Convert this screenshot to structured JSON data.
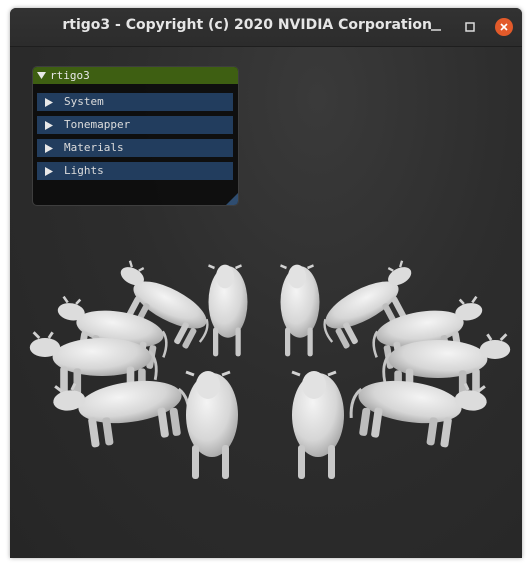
{
  "window": {
    "title": "rtigo3 - Copyright (c) 2020 NVIDIA Corporation",
    "minimize_glyph": "–",
    "maximize_glyph": "□",
    "close_glyph": "✕",
    "close_color": "#e25a2a"
  },
  "panel": {
    "title": "rtigo3",
    "expanded_icon": "triangle-down-icon",
    "header_color": "#3e5f12",
    "item_color": "#223d5e",
    "items": [
      {
        "label": "System",
        "icon": "triangle-right-icon"
      },
      {
        "label": "Tonemapper",
        "icon": "triangle-right-icon"
      },
      {
        "label": "Materials",
        "icon": "triangle-right-icon"
      },
      {
        "label": "Lights",
        "icon": "triangle-right-icon"
      }
    ]
  },
  "scene": {
    "subject": "ring of white cow models",
    "background_color": "#2d2d2d"
  }
}
